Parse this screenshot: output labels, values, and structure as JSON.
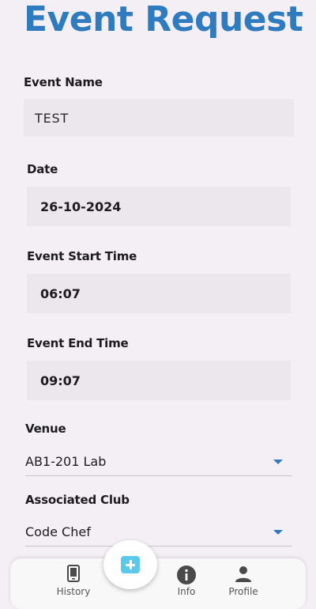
{
  "header": {
    "title": "Event Request"
  },
  "form": {
    "event_name": {
      "label": "Event Name",
      "value": "TEST"
    },
    "date": {
      "label": "Date",
      "value": "26-10-2024"
    },
    "start_time": {
      "label": "Event Start Time",
      "value": "06:07"
    },
    "end_time": {
      "label": "Event End Time",
      "value": "09:07"
    },
    "venue": {
      "label": "Venue",
      "value": "AB1-201 Lab"
    },
    "club": {
      "label": "Associated Club",
      "value": "Code Chef"
    }
  },
  "nav": {
    "items": [
      {
        "label": "History",
        "icon": "phone-icon"
      },
      {
        "label": "Info",
        "icon": "info-icon"
      },
      {
        "label": "Profile",
        "icon": "person-icon"
      }
    ],
    "fab_icon": "add-icon"
  },
  "colors": {
    "accent": "#2e7bbf",
    "background": "#f4eff5",
    "field_fill": "#ebe7ec",
    "fab": "#5bc8ec"
  }
}
